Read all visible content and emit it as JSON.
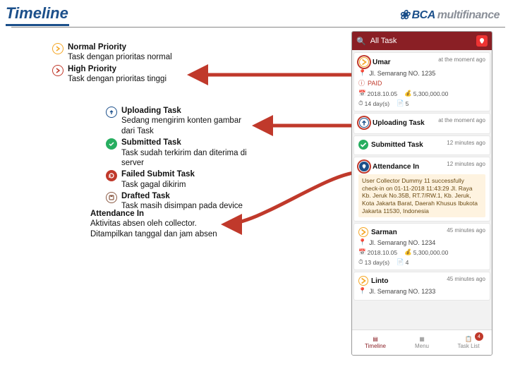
{
  "header": {
    "title": "Timeline",
    "logo_mark": "❀",
    "logo_bold": "BCA",
    "logo_light": "multifinance"
  },
  "legend_priority": {
    "normal_title": "Normal Priority",
    "normal_desc": "Task dengan prioritas normal",
    "high_title": "High Priority",
    "high_desc": "Task dengan prioritas tinggi"
  },
  "legend_status": {
    "uploading_title": "Uploading Task",
    "uploading_desc": "Sedang mengirim konten gambar dari Task",
    "submitted_title": "Submitted Task",
    "submitted_desc": "Task sudah terkirim dan diterima di server",
    "failed_title": "Failed Submit Task",
    "failed_desc": "Task gagal dikirim",
    "drafted_title": "Drafted Task",
    "drafted_desc": "Task masih disimpan pada device"
  },
  "legend_attendance": {
    "title": "Attendance In",
    "desc": "Aktivitas absen oleh collector. Ditampilkan tanggal dan jam absen"
  },
  "phone": {
    "header_search": "🔍",
    "header_label": "All Task",
    "card1": {
      "name": "Umar",
      "addr": "Jl. Semarang NO. 1235",
      "meta": "at the moment ago",
      "sub": "PAID",
      "date": "2018.10.05",
      "days": "14 day(s)",
      "amount": "5,300,000.00",
      "count": "5"
    },
    "uploading": {
      "title": "Uploading Task",
      "meta": "at the moment ago"
    },
    "submitted": {
      "title": "Submitted Task",
      "meta": "12 minutes ago"
    },
    "attendance": {
      "title": "Attendance In",
      "meta": "12 minutes ago",
      "body": "User Collector Dummy 11 successfully check-in on 01-11-2018 11:43:29 Jl. Raya Kb. Jeruk No.35B, RT.7/RW.1, Kb. Jeruk, Kota Jakarta Barat, Daerah Khusus Ibukota Jakarta 11530, Indonesia"
    },
    "card2": {
      "name": "Sarman",
      "addr": "Jl. Semarang NO. 1234",
      "meta": "45 minutes ago",
      "date": "2018.10.05",
      "days": "13 day(s)",
      "amount": "5,300,000.00",
      "count": "4"
    },
    "card3": {
      "name": "Linto",
      "addr": "Jl. Semarang NO. 1233",
      "meta": "45 minutes ago"
    },
    "nav": {
      "timeline": "Timeline",
      "menu": "Menu",
      "tasklist": "Task List",
      "badge": "4"
    }
  }
}
